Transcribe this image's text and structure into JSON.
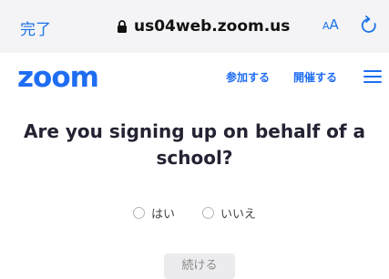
{
  "browser": {
    "done_label": "完了",
    "url": "us04web.zoom.us",
    "text_size_small": "A",
    "text_size_large": "A",
    "accent_color": "#1a73e8"
  },
  "header": {
    "logo_text": "zoom",
    "join_label": "参加する",
    "host_label": "開催する",
    "menu_icon": "hamburger-icon",
    "brand_color": "#1f6df2"
  },
  "main": {
    "question": "Are you signing up on behalf of a school?",
    "options": [
      {
        "label": "はい",
        "selected": false
      },
      {
        "label": "いいえ",
        "selected": false
      }
    ],
    "continue_label": "続ける"
  }
}
